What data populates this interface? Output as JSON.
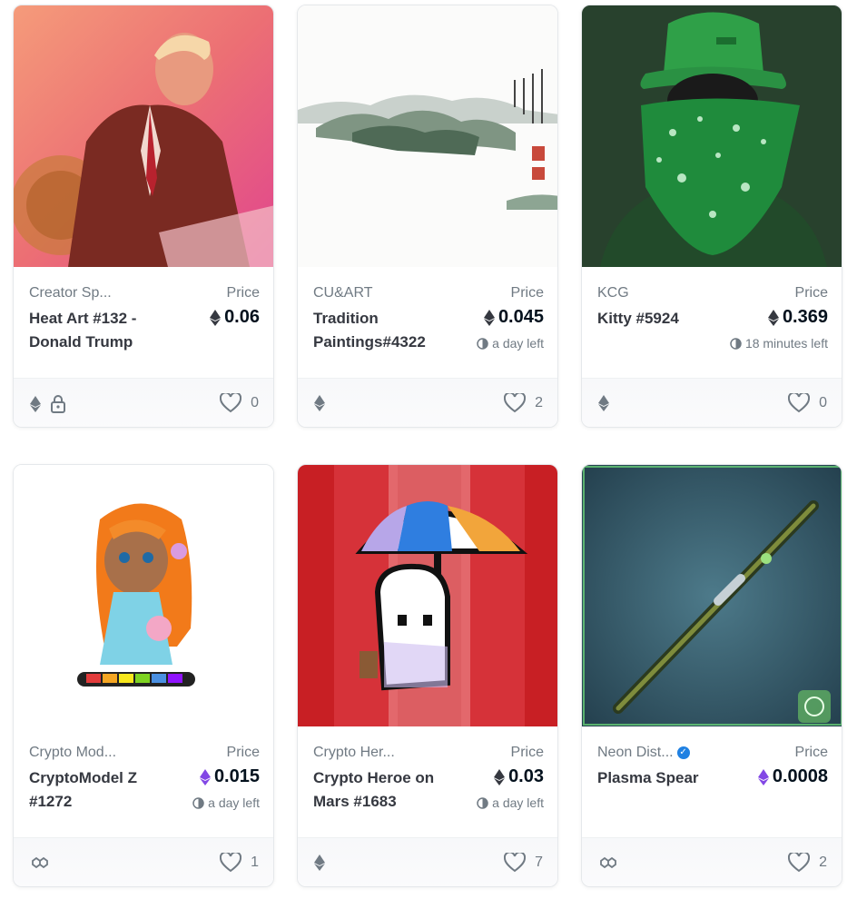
{
  "cards": [
    {
      "collection": "Creator Sp...",
      "name": "Heat Art #132 - Donald Trump",
      "price_label": "Price",
      "price": "0.06",
      "currency": "ETH",
      "time_left": "",
      "likes": "0",
      "chain": "ethereum",
      "locked": true
    },
    {
      "collection": "CU&ART",
      "name": "Tradition Paintings#4322",
      "price_label": "Price",
      "price": "0.045",
      "currency": "ETH",
      "time_left": "a day left",
      "likes": "2",
      "chain": "ethereum",
      "locked": false
    },
    {
      "collection": "KCG",
      "name": "Kitty #5924",
      "price_label": "Price",
      "price": "0.369",
      "currency": "ETH",
      "time_left": "18 minutes left",
      "likes": "0",
      "chain": "ethereum",
      "locked": false
    },
    {
      "collection": "Crypto Mod...",
      "name": "CryptoModel Z #1272",
      "price_label": "Price",
      "price": "0.015",
      "currency": "WETH",
      "time_left": "a day left",
      "likes": "1",
      "chain": "polygon",
      "locked": false
    },
    {
      "collection": "Crypto Her...",
      "name": "Crypto Heroe on Mars #1683",
      "price_label": "Price",
      "price": "0.03",
      "currency": "ETH",
      "time_left": "a day left",
      "likes": "7",
      "chain": "ethereum",
      "locked": false
    },
    {
      "collection": "Neon Dist...",
      "name": "Plasma Spear",
      "price_label": "Price",
      "price": "0.0008",
      "currency": "WETH",
      "time_left": "",
      "likes": "2",
      "chain": "polygon",
      "locked": false,
      "verified": true
    }
  ],
  "colors": {
    "weth": "#8247e5",
    "eth": "#353840",
    "muted": "#707a83"
  }
}
